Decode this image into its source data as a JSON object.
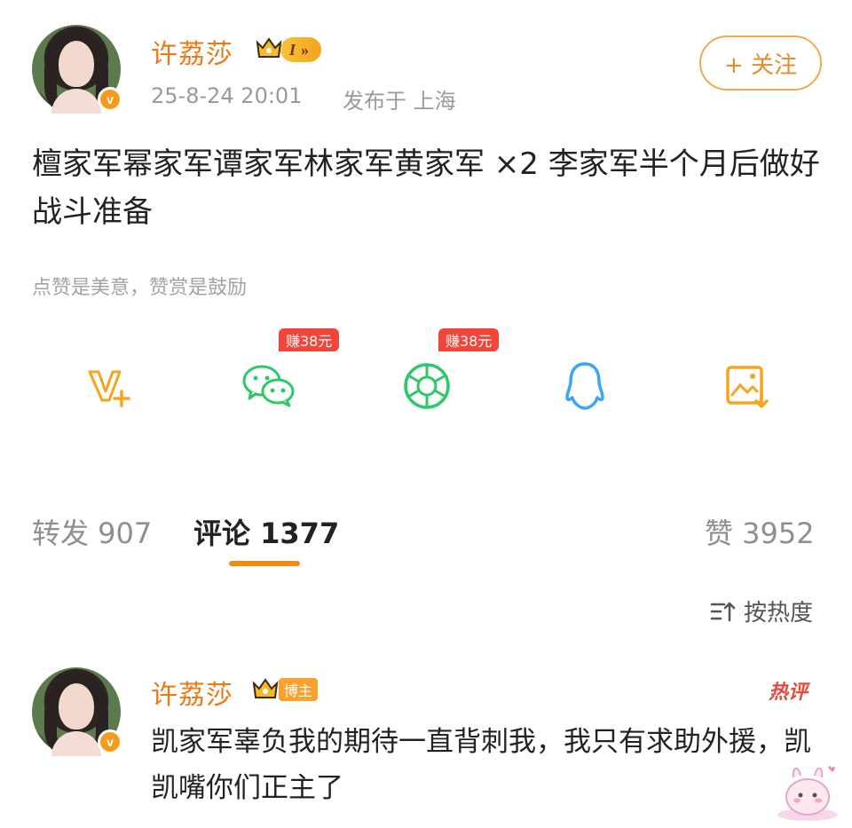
{
  "post": {
    "author": "许荔莎",
    "level_label": "I",
    "date": "25-8-24 20:01",
    "location": "发布于 上海",
    "follow_label": "+ 关注",
    "text": "檀家军幂家军谭家军林家军黄家军 ×2 李家军半个月后做好战斗准备",
    "reward_tip": "点赞是美意，赞赏是鼓励"
  },
  "share": {
    "items": [
      {
        "icon": "vplus-icon"
      },
      {
        "icon": "wechat-icon",
        "earn": "赚38元"
      },
      {
        "icon": "moments-icon",
        "earn": "赚38元"
      },
      {
        "icon": "qq-icon"
      },
      {
        "icon": "save-image-icon"
      }
    ]
  },
  "tabs": {
    "repost": "转发 907",
    "comments": "评论 1377",
    "likes": "赞 3952"
  },
  "sort": {
    "label": "按热度"
  },
  "comment": {
    "author": "许荔莎",
    "badge": "博主",
    "hot_label": "热评",
    "text": "凯家军辜负我的期待一直背刺我，我只有求助外援，凯凯嘴你们正主了"
  },
  "colors": {
    "accent": "#eb7a14",
    "earn_red": "#f2463a",
    "wechat_green": "#2dc86a",
    "qq_blue": "#3aa6f3"
  }
}
